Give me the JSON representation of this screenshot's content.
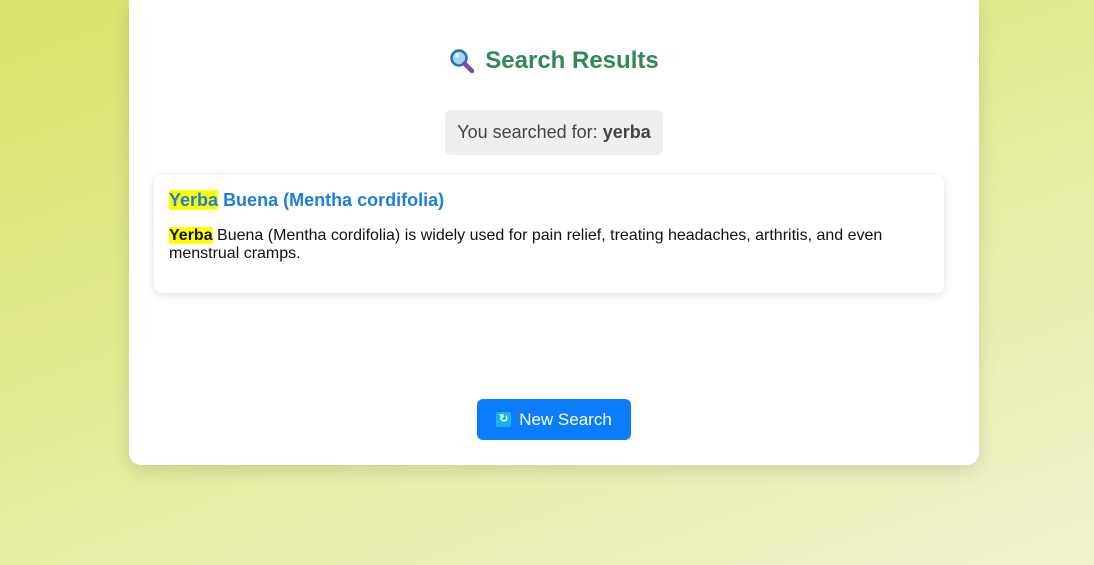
{
  "header": {
    "icon": "magnifying-glass-icon",
    "title": "Search Results"
  },
  "query": {
    "label": "You searched for:",
    "term": "yerba"
  },
  "results": [
    {
      "title_highlight": "Yerba",
      "title_rest": "Buena (Mentha cordifolia)",
      "desc_highlight": "Yerba",
      "desc_rest": "Buena (Mentha cordifolia) is widely used for pain relief, treating headaches, arthritis, and even menstrual cramps."
    }
  ],
  "actions": {
    "new_search_icon": "refresh-icon",
    "new_search_label": "New Search"
  },
  "colors": {
    "title": "#2e8b57",
    "link": "#1a7fe0",
    "highlight": "#ffff00",
    "button": "#0b7dfa"
  }
}
